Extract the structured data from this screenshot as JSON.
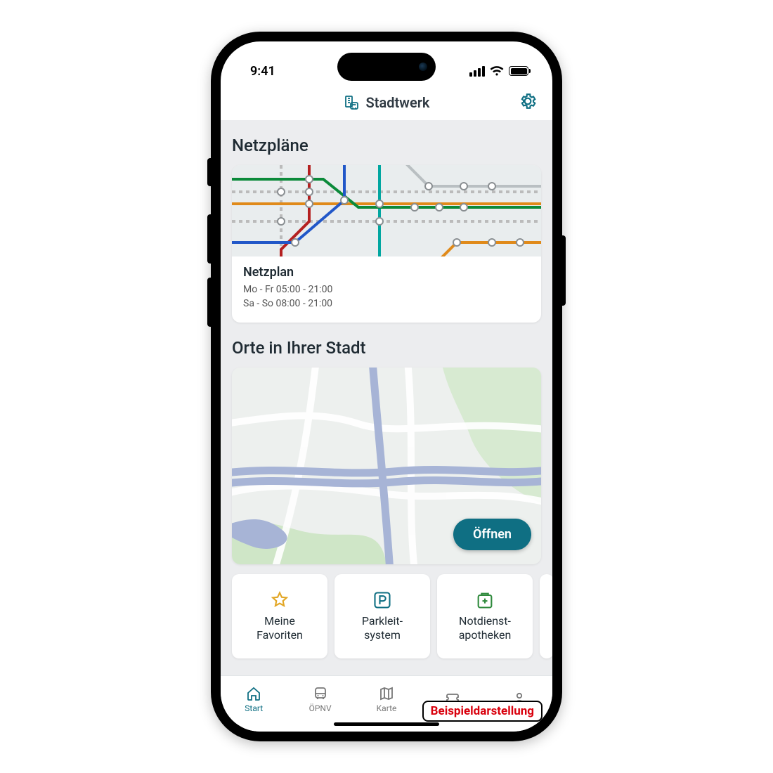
{
  "status": {
    "time": "9:41"
  },
  "header": {
    "app_name": "Stadtwerk"
  },
  "sections": {
    "netzplaene": {
      "heading": "Netzpläne",
      "card_title": "Netzplan",
      "hours_line1": "Mo - Fr 05:00 - 21:00",
      "hours_line2": "Sa - So 08:00 - 21:00"
    },
    "orte": {
      "heading": "Orte in Ihrer Stadt",
      "open_label": "Öffnen",
      "tiles": [
        {
          "icon": "star",
          "label": "Meine\nFavoriten"
        },
        {
          "icon": "parking",
          "label": "Parkleit-\nsystem"
        },
        {
          "icon": "pharmacy",
          "label": "Notdienst-\napotheken"
        }
      ]
    }
  },
  "tabs": [
    {
      "icon": "home",
      "label": "Start",
      "active": true
    },
    {
      "icon": "bus",
      "label": "ÖPNV"
    },
    {
      "icon": "map",
      "label": "Karte"
    },
    {
      "icon": "ticket",
      "label": ""
    },
    {
      "icon": "person",
      "label": ""
    }
  ],
  "example_badge": "Beispieldarstellung",
  "colors": {
    "accent": "#0f6f83"
  }
}
